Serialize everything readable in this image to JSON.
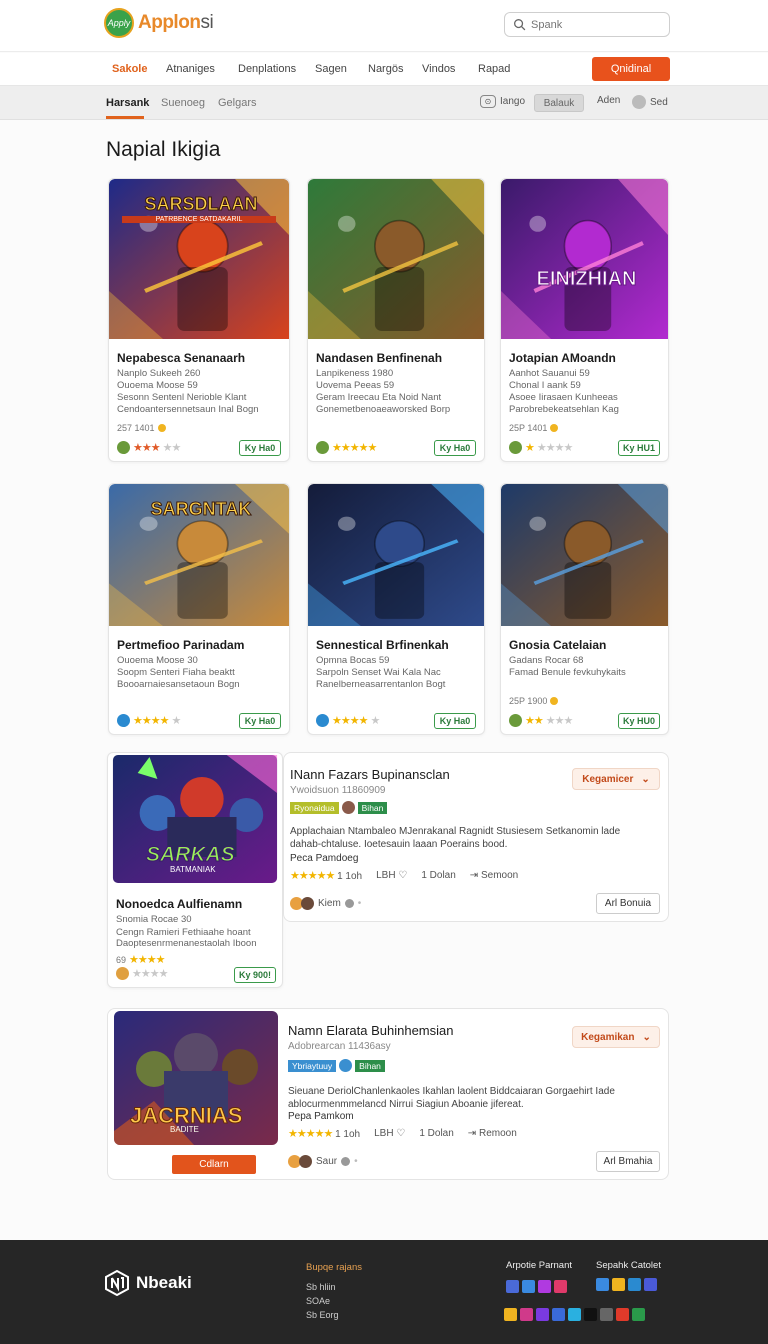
{
  "header": {
    "logo_mark": "Apply",
    "logo_text_main": "Applon",
    "logo_text_end": "si",
    "search_placeholder": "Spank"
  },
  "nav": {
    "items": [
      "Sakole",
      "Atnaniges",
      "Denplations",
      "Sagen",
      "Nargös",
      "Vindos",
      "Rapad"
    ],
    "cta": "Qnidinal"
  },
  "subnav": {
    "tabs": [
      "Harsank",
      "Suenoeg",
      "Gelgars"
    ],
    "sort_label": "Iango",
    "filter_button": "Balauk",
    "user_label": "Aden",
    "settings_label": "Sed"
  },
  "page_title": "Napial Ikigia",
  "cards": [
    {
      "image_caption": "SARSDLAAN",
      "image_sub": "PATRBENCE SATDAKARIL",
      "title": "Nepabesca Senanaarh",
      "line1": "Nanplo Sukeeh 260",
      "line2": "Ouoema Moose 59",
      "line3": "Sesonn Sentenl Nerioble Klant",
      "line4": "Cendoantersennetsaun Inal Bogn",
      "score": "257 1401",
      "stars_on": 3,
      "button": "Ky Ha0",
      "colors": [
        "#1e2a88",
        "#d8431c",
        "#ffc93a"
      ]
    },
    {
      "image_caption": "",
      "image_sub": "",
      "title": "Nandasen Benfinenah",
      "line1": "Lanpikeness 1980",
      "line2": "Uovema Peeas 59",
      "line3": "Geram Ireecau Eta Noid Nant",
      "line4": "Gonemetbenoaeaworsked Borp",
      "score": "",
      "stars_on": 5,
      "button": "Ky Ha0",
      "colors": [
        "#2e7a3a",
        "#8a5a2a",
        "#f2c440"
      ]
    },
    {
      "image_caption": "EINIZHIAN",
      "image_sub": "",
      "title": "Jotapian AMoandn",
      "line1": "Aanhot Sauanui 59",
      "line2": "Chonal I aank 59",
      "line3": "Asoee Iirasaen Kunheeas",
      "line4": "Parobrebekeatsehlan Kag",
      "score": "25P 1401",
      "stars_on": 1,
      "button": "Ky HU1",
      "colors": [
        "#3a1a6a",
        "#b22ad0",
        "#ff7fd8"
      ]
    },
    {
      "image_caption": "SARGNTAK",
      "image_sub": "",
      "title": "Pertmefioo Parinadam",
      "line1": "Ouoema Moose 30",
      "line2": "Soopm Senteri Fiaha beaktt",
      "line3": "Boooarnaiesansetaoun Bogn",
      "line4": "",
      "score": "",
      "stars_on": 4,
      "button": "Ky Ha0",
      "colors": [
        "#3a6aa8",
        "#c88a3a",
        "#f4c04a"
      ]
    },
    {
      "image_caption": "",
      "image_sub": "",
      "title": "Sennestical Brfinenkah",
      "line1": "Opmna Bocas 59",
      "line2": "Sarpoln Senset Wai Kala Nac",
      "line3": "Ranelberneasarrentanlon Bogt",
      "line4": "",
      "score": "",
      "stars_on": 4,
      "button": "Ky Ha0",
      "colors": [
        "#141c3a",
        "#2e4a8a",
        "#4ab8ff"
      ]
    },
    {
      "image_caption": "",
      "image_sub": "",
      "title": "Gnosia Catelaian",
      "line1": "Gadans Rocar 68",
      "line2": "Famad Benule fevkuhykaits",
      "line3": "",
      "line4": "",
      "score": "25P 1900",
      "stars_on": 2,
      "button": "Ky HU0",
      "colors": [
        "#1e3a68",
        "#8a5a2a",
        "#5aa0e0"
      ]
    }
  ],
  "featured_rows": [
    {
      "card_title": "Nonoedca Aulfienamn",
      "card_line1": "Snomia Rocae 30",
      "card_line2": "Cengn Ramieri Fethiaahe hoant",
      "card_line3": "Daoptesenrmenanestaolah Iboon",
      "card_score": "69",
      "card_button": "Ky 900!",
      "image_caption": "SARKAS",
      "image_sub": "BATMANIAK",
      "title": "INann Fazars Bupinansclan",
      "subtitle": "Ywoidsuon 11860909",
      "tag1": "Ryonaidua",
      "tag2": "Bihan",
      "description": "Applachaian Ntambaleo MJenrakanal Ragnidt Stusiesem Setkanomin lade dahab-chtaluse. Ioetesauin laaan Poerains bood.",
      "by": "Peca Pamdoeg",
      "rating": "1 1oh",
      "meta2": "LBH",
      "meta3": "1 Dolan",
      "meta4": "Semoon",
      "author": "Kiem",
      "dropdown": "Kegamicer",
      "action": "Arl Bonuia",
      "colors": [
        "#1a2a6a",
        "#d03a2a",
        "#7aff6a"
      ]
    },
    {
      "card_title": "",
      "card_line1": "",
      "card_line2": "",
      "card_line3": "",
      "card_score": "",
      "card_button": "",
      "image_caption": "JACRNIAS",
      "image_sub": "BADITE",
      "title": "Namn Elarata Buhinhemsian",
      "subtitle": "Adobrearcan 11436asy",
      "tag1": "Ybriaytuuy",
      "tag2": "Bihan",
      "description": "Sieuane DeriolChanlenkaoles Ikahlan laolent Biddcaiaran Gorgaehirt Iade ablocurmenmmelancd Nirrui Siagiun Aboanie jifereat.",
      "by": "Pepa Pamkom",
      "rating": "1 1oh",
      "meta2": "LBH",
      "meta3": "1 Dolan",
      "meta4": "Remoon",
      "author": "Saur",
      "dropdown": "Kegamikan",
      "action": "Arl Bmahia",
      "orange_button": "Cdlarn",
      "colors": [
        "#2a2a7a",
        "#d85a1a",
        "#ffc84a"
      ]
    }
  ],
  "footer": {
    "brand": "Nbeaki",
    "col1_title": "Bupqe rajans",
    "col1_links": [
      "Sb hliin",
      "SOAe",
      "Sb Eorg"
    ],
    "col2_title": "Arpotie Parnant",
    "col3_title": "Sepahk Catolet"
  }
}
